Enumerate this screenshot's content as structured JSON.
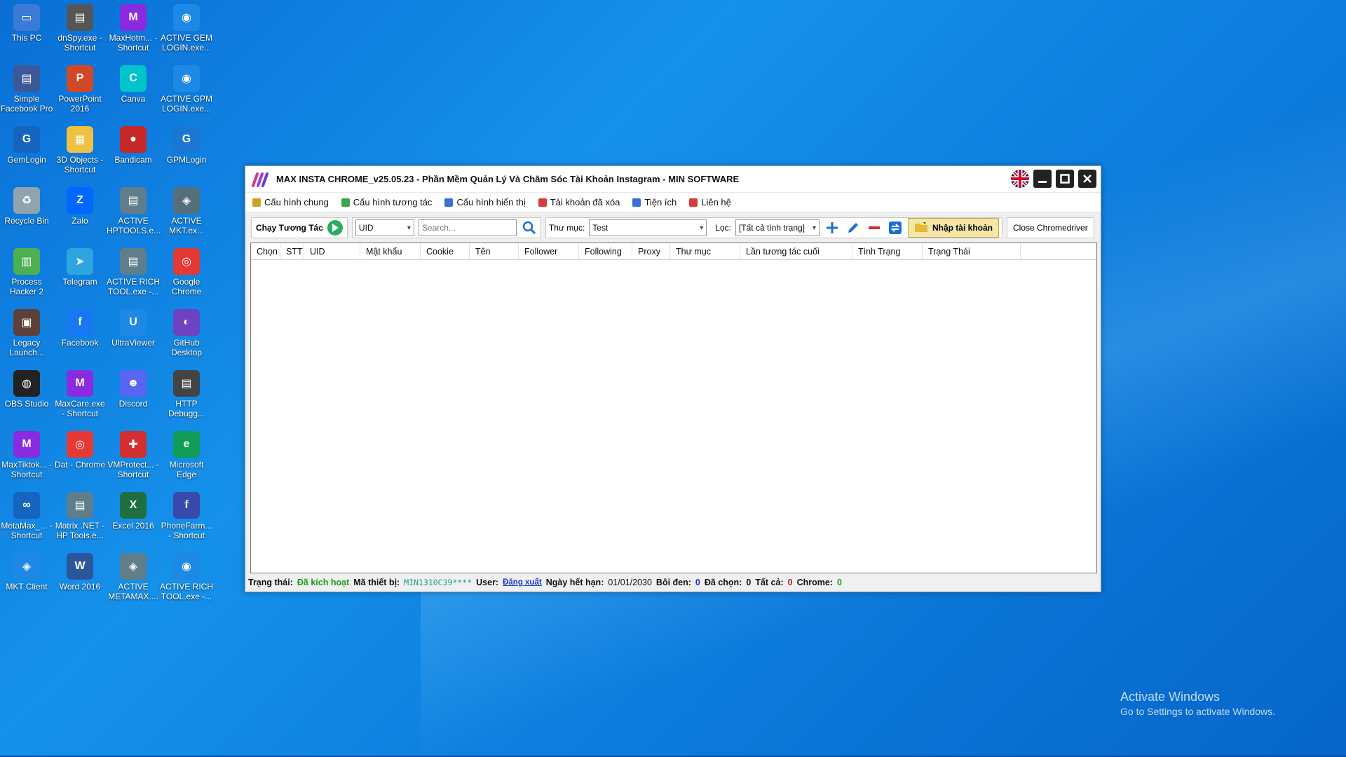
{
  "desktop": {
    "icons": [
      {
        "label": "This PC",
        "color": "#3a7bd5",
        "glyph": "▭"
      },
      {
        "label": "dnSpy.exe - Shortcut",
        "color": "#555",
        "glyph": "▤"
      },
      {
        "label": "MaxHotm... - Shortcut",
        "color": "#8a2be2",
        "glyph": "M"
      },
      {
        "label": "ACTIVE GEM LOGIN.exe...",
        "color": "#1e88e5",
        "glyph": "◉"
      },
      {
        "label": "Simple Facebook Pro",
        "color": "#3b5998",
        "glyph": "▤"
      },
      {
        "label": "PowerPoint 2016",
        "color": "#d24726",
        "glyph": "P"
      },
      {
        "label": "Canva",
        "color": "#00c4cc",
        "glyph": "C"
      },
      {
        "label": "ACTIVE GPM LOGIN.exe...",
        "color": "#1e88e5",
        "glyph": "◉"
      },
      {
        "label": "GemLogin",
        "color": "#1565c0",
        "glyph": "G"
      },
      {
        "label": "3D Objects - Shortcut",
        "color": "#f0c040",
        "glyph": "▦"
      },
      {
        "label": "Bandicam",
        "color": "#c62828",
        "glyph": "●"
      },
      {
        "label": "GPMLogin",
        "color": "#1976d2",
        "glyph": "G"
      },
      {
        "label": "Recycle Bin",
        "color": "#90a4ae",
        "glyph": "♻"
      },
      {
        "label": "Zalo",
        "color": "#0068ff",
        "glyph": "Z"
      },
      {
        "label": "ACTIVE HPTOOLS.e...",
        "color": "#607d8b",
        "glyph": "▤"
      },
      {
        "label": "ACTIVE MKT.ex...",
        "color": "#546e7a",
        "glyph": "◈"
      },
      {
        "label": "Process Hacker 2",
        "color": "#4caf50",
        "glyph": "▥"
      },
      {
        "label": "Telegram",
        "color": "#2ca5e0",
        "glyph": "➤"
      },
      {
        "label": "ACTIVE RICH TOOL.exe -...",
        "color": "#607d8b",
        "glyph": "▤"
      },
      {
        "label": "Google Chrome",
        "color": "#e53935",
        "glyph": "◎"
      },
      {
        "label": "Legacy Launch...",
        "color": "#5d4037",
        "glyph": "▣"
      },
      {
        "label": "Facebook",
        "color": "#1877f2",
        "glyph": "f"
      },
      {
        "label": "UltraViewer",
        "color": "#1e88e5",
        "glyph": "U"
      },
      {
        "label": "GitHub Desktop",
        "color": "#6f42c1",
        "glyph": "◐"
      },
      {
        "label": "OBS Studio",
        "color": "#222",
        "glyph": "◍"
      },
      {
        "label": "MaxCare.exe - Shortcut",
        "color": "#8a2be2",
        "glyph": "M"
      },
      {
        "label": "Discord",
        "color": "#5865f2",
        "glyph": "☻"
      },
      {
        "label": "HTTP Debugg...",
        "color": "#444",
        "glyph": "▤"
      },
      {
        "label": "MaxTiktok... - Shortcut",
        "color": "#8a2be2",
        "glyph": "M"
      },
      {
        "label": "Dat - Chrome",
        "color": "#e53935",
        "glyph": "◎"
      },
      {
        "label": "VMProtect... - Shortcut",
        "color": "#d32f2f",
        "glyph": "✚"
      },
      {
        "label": "Microsoft Edge",
        "color": "#0f9d58",
        "glyph": "e"
      },
      {
        "label": "MetaMax_... - Shortcut",
        "color": "#1565c0",
        "glyph": "∞"
      },
      {
        "label": "Matrix .NET - HP Tools.e...",
        "color": "#607d8b",
        "glyph": "▤"
      },
      {
        "label": "Excel 2016",
        "color": "#1d6f42",
        "glyph": "X"
      },
      {
        "label": "PhoneFarm... - Shortcut",
        "color": "#3949ab",
        "glyph": "f"
      },
      {
        "label": "MKT Client",
        "color": "#1e88e5",
        "glyph": "◈"
      },
      {
        "label": "Word 2016",
        "color": "#2b579a",
        "glyph": "W"
      },
      {
        "label": "ACTIVE METAMAX....",
        "color": "#607d8b",
        "glyph": "◈"
      },
      {
        "label": "ACTIVE RICH TOOL.exe -...",
        "color": "#1e88e5",
        "glyph": "◉"
      }
    ]
  },
  "window": {
    "title": "MAX INSTA CHROME_v25.05.23 - Phần Mềm Quản Lý Và Chăm Sóc Tài Khoản Instagram - MIN SOFTWARE",
    "menu": [
      {
        "label": "Cấu hình chung",
        "color": "#c9a227"
      },
      {
        "label": "Cấu hình tương tác",
        "color": "#3fa34d"
      },
      {
        "label": "Cấu hình hiển thị",
        "color": "#3a6fd6"
      },
      {
        "label": "Tài khoản đã xóa",
        "color": "#d83b3b"
      },
      {
        "label": "Tiện ích",
        "color": "#3a6fd6"
      },
      {
        "label": "Liên hệ",
        "color": "#d83b3b"
      }
    ],
    "toolbar": {
      "run_label": "Chạy Tương Tác",
      "field_select": "UID",
      "search_placeholder": "Search...",
      "folder_label": "Thư mục:",
      "folder_value": "Test",
      "filter_label": "Lọc:",
      "filter_value": "[Tất cả tình trạng]",
      "import_label": "Nhập tài khoản",
      "close_driver_label": "Close Chromedriver"
    },
    "grid": {
      "columns": [
        "Chọn",
        "STT",
        "UID",
        "Mật khẩu",
        "Cookie",
        "Tên",
        "Follower",
        "Following",
        "Proxy",
        "Thư mục",
        "Lần tương tác cuối",
        "Tình Trạng",
        "Trạng Thái"
      ],
      "rows": []
    },
    "status": {
      "state_label": "Trạng thái:",
      "state_value": "Đã kích hoạt",
      "device_label": "Mã thiết bị:",
      "device_value": "MIN1310C39****",
      "user_label": "User:",
      "user_value": "Đăng xuất",
      "expiry_label": "Ngày hết hạn:",
      "expiry_value": "01/01/2030",
      "black_label": "Bôi đen:",
      "black_value": "0",
      "selected_label": "Đã chọn:",
      "selected_value": "0",
      "all_label": "Tất cả:",
      "all_value": "0",
      "chrome_label": "Chrome:",
      "chrome_value": "0"
    }
  },
  "activation": {
    "line1": "Activate Windows",
    "line2": "Go to Settings to activate Windows."
  }
}
